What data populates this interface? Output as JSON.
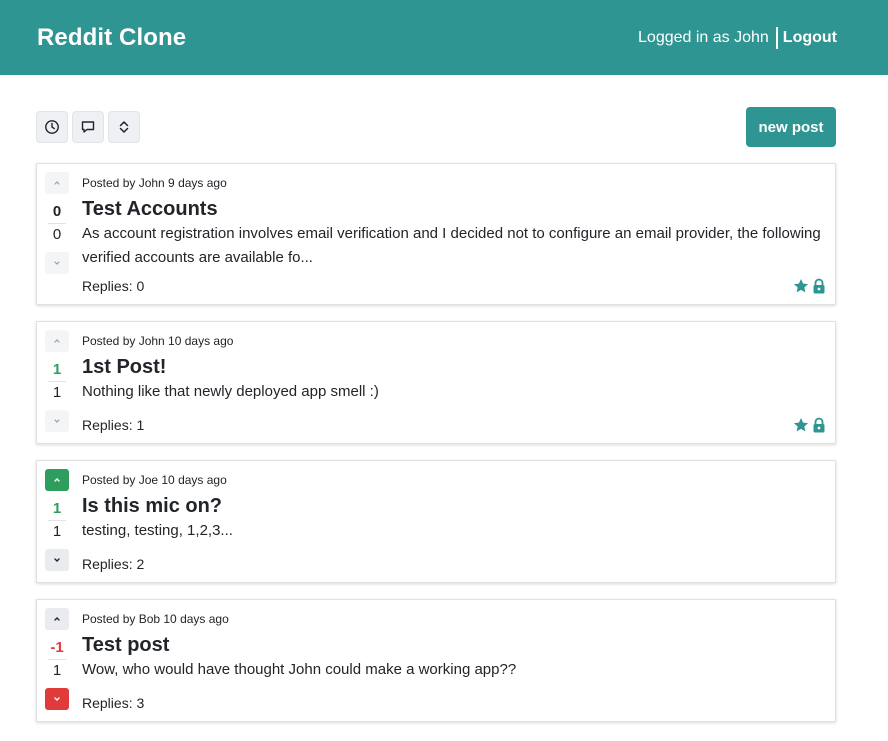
{
  "navbar": {
    "brand": "Reddit Clone",
    "logged_in_text": "Logged in as John",
    "logout_label": "Logout"
  },
  "toolbar": {
    "sort_buttons": [
      "clock-icon",
      "comment-icon",
      "sort-updown-icon"
    ],
    "new_post_label": "new post"
  },
  "colors": {
    "brand": "#2f9592",
    "upvote": "#2e9e5e",
    "downvote": "#e03a3a"
  },
  "posts": [
    {
      "meta": "Posted by John 9 days ago",
      "title": "Test Accounts",
      "text": "As account registration involves email verification and I decided not to configure an email provider, the following verified accounts are available fo...",
      "score": "0",
      "reply_count": "0",
      "replies": "Replies: 0",
      "vote_state": "none",
      "badges": [
        "star-icon",
        "lock-icon"
      ]
    },
    {
      "meta": "Posted by John 10 days ago",
      "title": "1st Post!",
      "text": "Nothing like that newly deployed app smell :)",
      "score": "1",
      "reply_count": "1",
      "replies": "Replies: 1",
      "vote_state": "none",
      "badges": [
        "star-icon",
        "lock-icon"
      ]
    },
    {
      "meta": "Posted by Joe 10 days ago",
      "title": "Is this mic on?",
      "text": "testing, testing, 1,2,3...",
      "score": "1",
      "reply_count": "1",
      "replies": "Replies: 2",
      "vote_state": "upvoted",
      "badges": []
    },
    {
      "meta": "Posted by Bob 10 days ago",
      "title": "Test post",
      "text": "Wow, who would have thought John could make a working app??",
      "score": "-1",
      "reply_count": "1",
      "replies": "Replies: 3",
      "vote_state": "downvoted",
      "badges": []
    }
  ]
}
